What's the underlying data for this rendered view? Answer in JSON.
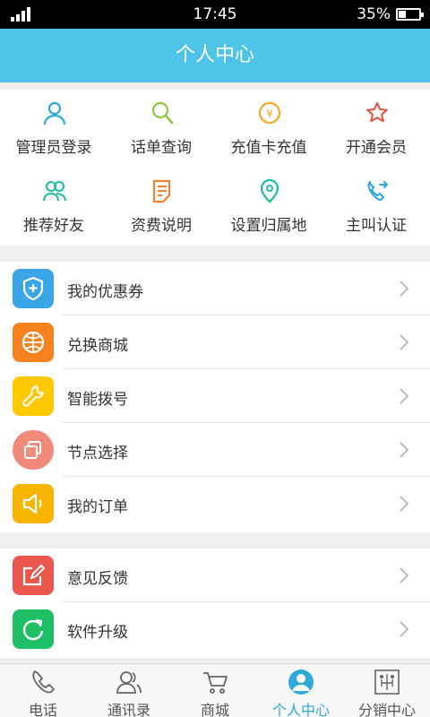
{
  "status_bar": {
    "time": "17:45",
    "battery": "35%",
    "battery_level": 0.35
  },
  "header": {
    "title": "个人中心"
  },
  "quick_actions": [
    {
      "label": "管理员登录",
      "icon": "user-icon",
      "color": "#2aa8dc"
    },
    {
      "label": "话单查询",
      "icon": "search-icon",
      "color": "#8dc63f"
    },
    {
      "label": "充值卡充值",
      "icon": "yen-coin-icon",
      "color": "#f5a623"
    },
    {
      "label": "开通会员",
      "icon": "star-icon",
      "color": "#e94e3c"
    },
    {
      "label": "推荐好友",
      "icon": "users-icon",
      "color": "#1abc9c"
    },
    {
      "label": "资费说明",
      "icon": "document-icon",
      "color": "#f5822a"
    },
    {
      "label": "设置归属地",
      "icon": "location-pin-icon",
      "color": "#1abc9c"
    },
    {
      "label": "主叫认证",
      "icon": "phone-forward-icon",
      "color": "#2aa8dc"
    }
  ],
  "menu_group_1": [
    {
      "label": "我的优惠券",
      "icon": "shield-plus-icon",
      "color": "#3aa6e6"
    },
    {
      "label": "兑换商城",
      "icon": "globe-icon",
      "color": "#f5821f"
    },
    {
      "label": "智能拨号",
      "icon": "wrench-icon",
      "color": "#ffc800"
    },
    {
      "label": "节点选择",
      "icon": "nodes-icon",
      "color": "#f08a7a"
    },
    {
      "label": "我的订单",
      "icon": "speaker-icon",
      "color": "#f7b500"
    }
  ],
  "menu_group_2": [
    {
      "label": "意见反馈",
      "icon": "edit-icon",
      "color": "#e9574e"
    },
    {
      "label": "软件升级",
      "icon": "refresh-icon",
      "color": "#1fbf66"
    }
  ],
  "tabs": [
    {
      "label": "电话",
      "icon": "phone-icon",
      "active": false
    },
    {
      "label": "通讯录",
      "icon": "contacts-icon",
      "active": false
    },
    {
      "label": "商城",
      "icon": "cart-icon",
      "active": false
    },
    {
      "label": "个人中心",
      "icon": "profile-icon",
      "active": true
    },
    {
      "label": "分销中心",
      "icon": "distribution-icon",
      "active": false
    }
  ],
  "colors": {
    "header": "#4ec4e8",
    "active_tab": "#2fa9d7"
  }
}
